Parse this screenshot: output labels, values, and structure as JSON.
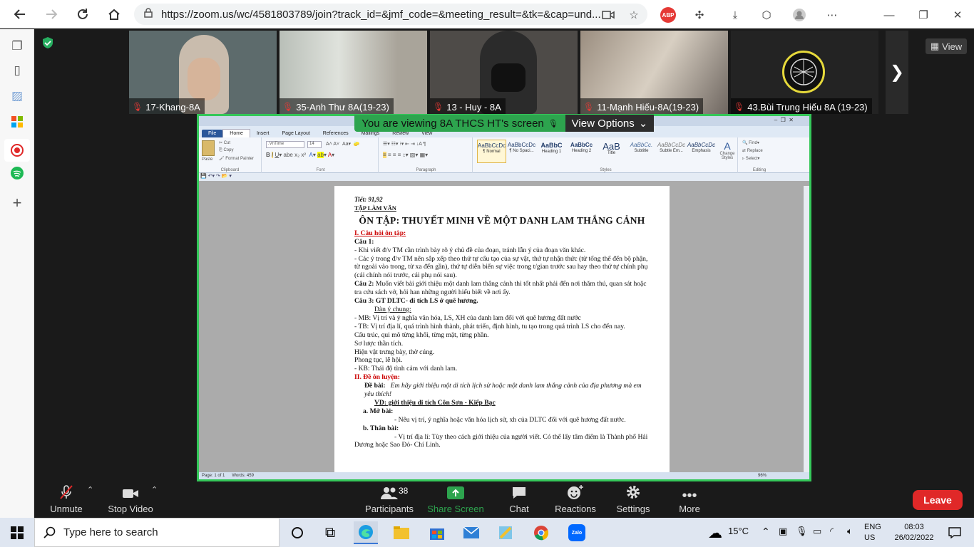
{
  "browser": {
    "url": "https://zoom.us/wc/4581803789/join?track_id=&jmf_code=&meeting_result=&tk=&cap=und..."
  },
  "participants_strip": {
    "tiles": [
      {
        "name": "17-Khang-8A"
      },
      {
        "name": "35-Anh Thư 8A(19-23)"
      },
      {
        "name": "13 - Huy - 8A"
      },
      {
        "name": "11-Mạnh Hiếu-8A(19-23)"
      },
      {
        "name": "43.Bùi Trung Hiếu 8A (19-23)"
      }
    ],
    "view_label": "View"
  },
  "share": {
    "viewing_text": "You are viewing 8A THCS HT's screen",
    "view_options": "View Options"
  },
  "word": {
    "tabs": [
      "File",
      "Home",
      "Insert",
      "Page Layout",
      "References",
      "Mailings",
      "Review",
      "View"
    ],
    "font_name": ".VnTime",
    "font_size": "14",
    "clipboard": {
      "paste": "Paste",
      "cut": "Cut",
      "copy": "Copy",
      "format_painter": "Format Painter"
    },
    "group_labels": [
      "Clipboard",
      "Font",
      "Paragraph",
      "Styles",
      "Editing"
    ],
    "styles": [
      {
        "preview": "AaBbCcDc",
        "name": "¶ Normal"
      },
      {
        "preview": "AaBbCcDc",
        "name": "¶ No Spaci..."
      },
      {
        "preview": "AaBbC",
        "name": "Heading 1"
      },
      {
        "preview": "AaBbCc",
        "name": "Heading 2"
      },
      {
        "preview": "AaB",
        "name": "Title"
      },
      {
        "preview": "AaBbCc.",
        "name": "Subtitle"
      },
      {
        "preview": "AaBbCcDc",
        "name": "Subtle Em..."
      },
      {
        "preview": "AaBbCcDc",
        "name": "Emphasis"
      }
    ],
    "change_styles": "Change Styles",
    "editing": {
      "find": "Find",
      "replace": "Replace",
      "select": "Select"
    },
    "status": {
      "page": "Page: 1 of 1",
      "words": "Words: 459",
      "zoom": "96%"
    },
    "doc": {
      "line1": "Tiết: 91,92",
      "line2": "TẬP LÀM VĂN",
      "title": "ÔN TẬP: THUYẾT MINH VỀ MỘT DANH LAM THẮNG CẢNH",
      "s1": "I. Câu hỏi ôn tập:",
      "c1": "Câu 1:",
      "p1": "- Khi viết đ/v TM cần trình bày rõ ý chủ đề của đoạn, tránh lẫn ý của đoạn văn khác.",
      "p2": "- Các ý trong đ/v TM nên sắp xếp theo thứ tự cấu tạo của sự vật, thứ tự nhận thức (từ tổng thể đến bộ phận, từ ngoài vào trong, từ xa đến gần), thứ tự diễn biến sự việc trong t/gian trước sau hay theo thứ tự chính phụ (cái chính nói trước, cái phụ nói sau).",
      "c2": "Câu 2:",
      "p3": " Muốn viết bài giới thiệu một danh lam thắng cảnh thì tốt nhất phải đến nơi thăm thú, quan sát hoặc tra cứu sách vở, hỏi han những người hiểu biết về nơi ấy.",
      "c3": "Câu 3: GT DLTC- di tích LS ở quê hương.",
      "p4": "Dàn ý chung:",
      "p5": "- MB: Vị trí và ý nghĩa văn hóa, LS, XH của danh lam đối với quê hương đất nước",
      "p6": "- TB: Vị trí địa lí, quá trình hình thành, phát triển, định hình, tu tạo trong quá trình LS cho đến nay.",
      "p7": "Cấu trúc, qui mô từng khối, từng mặt, từng phần.",
      "p8": "Sơ lược thần tích.",
      "p9": "Hiện vật trưng bày, thờ cúng.",
      "p10": "Phong tục, lễ hội.",
      "p11": "- KB: Thái độ tình cảm với danh lam.",
      "s2": "II. Đề ôn luyện:",
      "de_label": "Đề bài:",
      "de_text": "Em hãy giới thiệu một di tích lịch sử hoặc một danh lam thắng cảnh của địa phương mà em yêu thích!",
      "vd": "VD: giới thiệu di tích Côn Sơn - Kiếp Bạc",
      "a": "a. Mở bài:",
      "a1": "- Nêu vị trí, ý nghĩa hoặc văn hóa lịch sử, xh của DLTC đối với quê hương đất nước.",
      "b": "b.  Thân bài:",
      "b1": "- Vị trí địa lí: Tùy theo cách giới thiệu của người viết. Có thể lấy tâm điểm là Thành phố Hải Dương hoặc Sao Đỏ- Chí Linh."
    }
  },
  "toolbar": {
    "unmute": "Unmute",
    "stop_video": "Stop Video",
    "participants": "Participants",
    "participants_count": "38",
    "share_screen": "Share Screen",
    "chat": "Chat",
    "reactions": "Reactions",
    "settings": "Settings",
    "more": "More",
    "leave": "Leave"
  },
  "taskbar": {
    "search_placeholder": "Type here to search",
    "weather": "15°C",
    "lang1": "ENG",
    "lang2": "US",
    "time": "08:03",
    "date": "26/02/2022"
  },
  "colors": {
    "share_border": "#34c759",
    "leave": "#e02828",
    "share_icon": "#2da44e"
  }
}
